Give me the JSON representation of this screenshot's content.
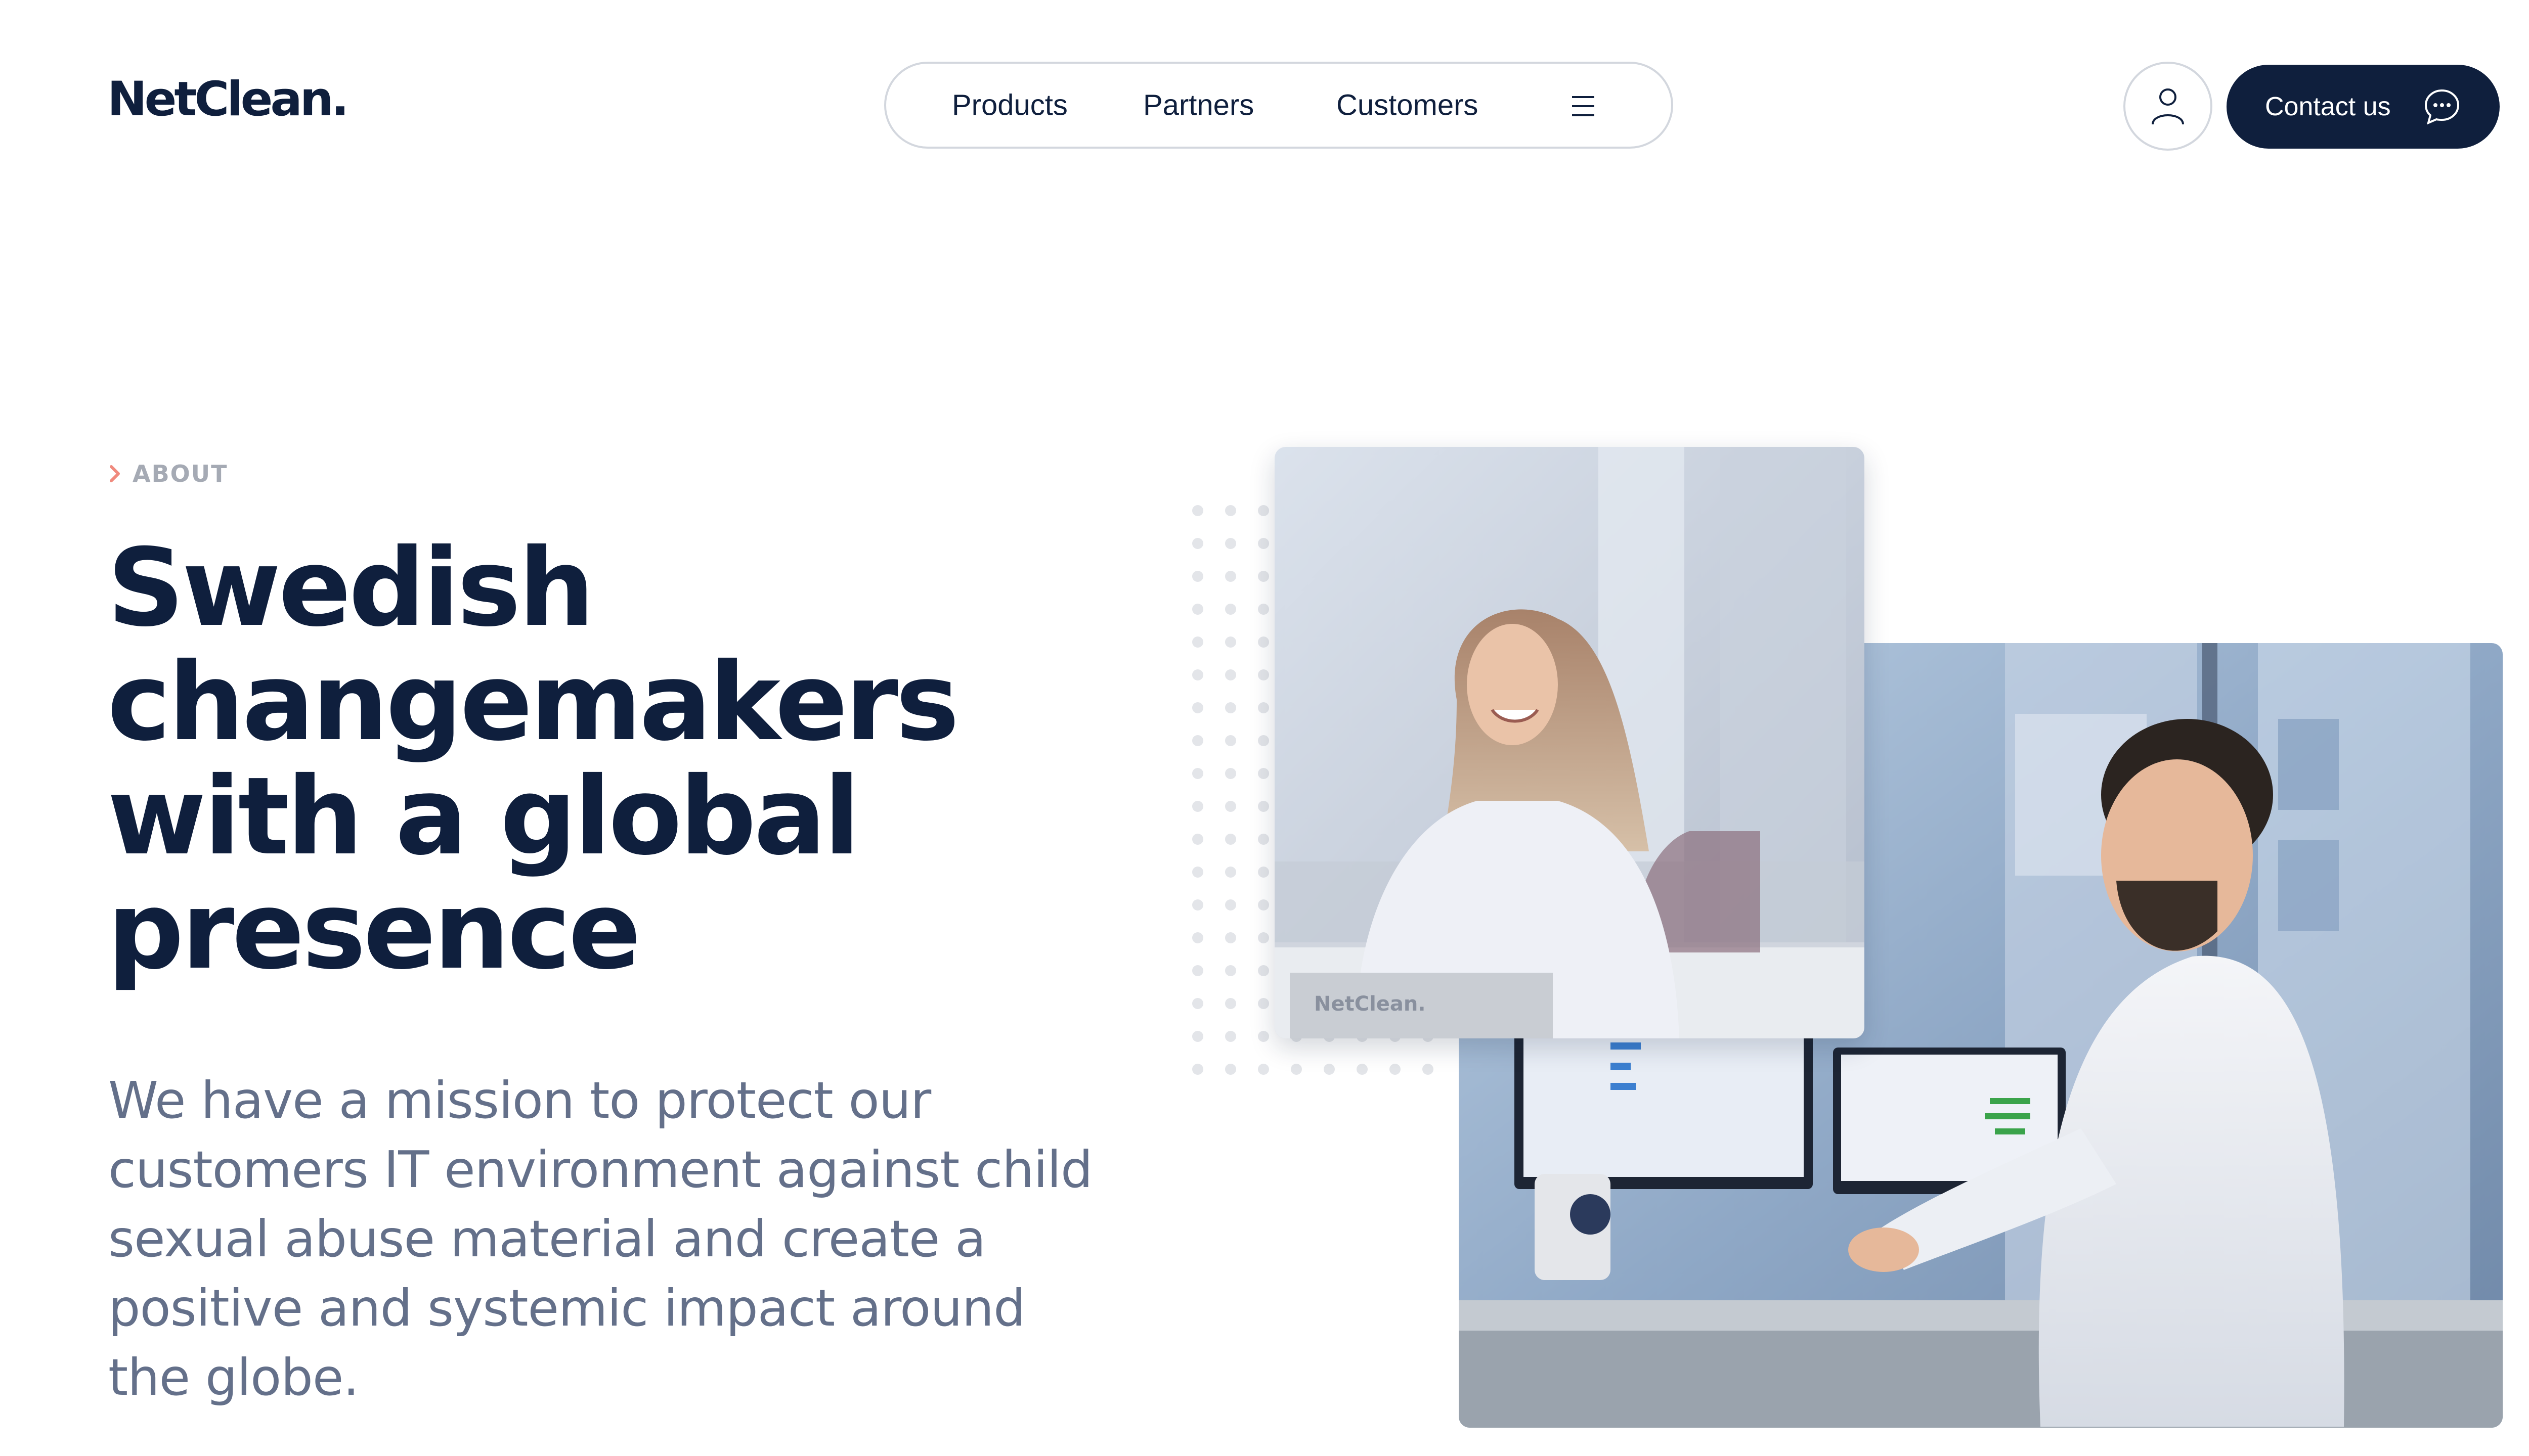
{
  "header": {
    "logo_text": "NetClean.",
    "nav": {
      "items": [
        {
          "label": "Products"
        },
        {
          "label": "Partners"
        },
        {
          "label": "Customers"
        }
      ],
      "menu_icon": "hamburger-menu-icon"
    },
    "account_icon": "user-icon",
    "contact_button": {
      "label": "Contact us",
      "icon": "chat-bubble-icon"
    }
  },
  "hero": {
    "eyebrow": "ABOUT",
    "eyebrow_icon": "chevron-right-icon",
    "headline": "Swedish changemakers with a global presence",
    "mission": "We have a mission to protect our customers IT environment against child sexual abuse material and create a positive and systemic impact around the globe.",
    "images": [
      {
        "name": "woman-smiling-photo",
        "overlay_text": "NetClean."
      },
      {
        "name": "man-at-computer-photo"
      }
    ]
  },
  "colors": {
    "brand_navy": "#0f1f3d",
    "text_muted": "#64708a",
    "eyebrow_gray": "#a5aab4",
    "accent_coral": "#f08a7e",
    "border_light": "#d3d7de",
    "dot_gray": "#e3e5e9"
  }
}
